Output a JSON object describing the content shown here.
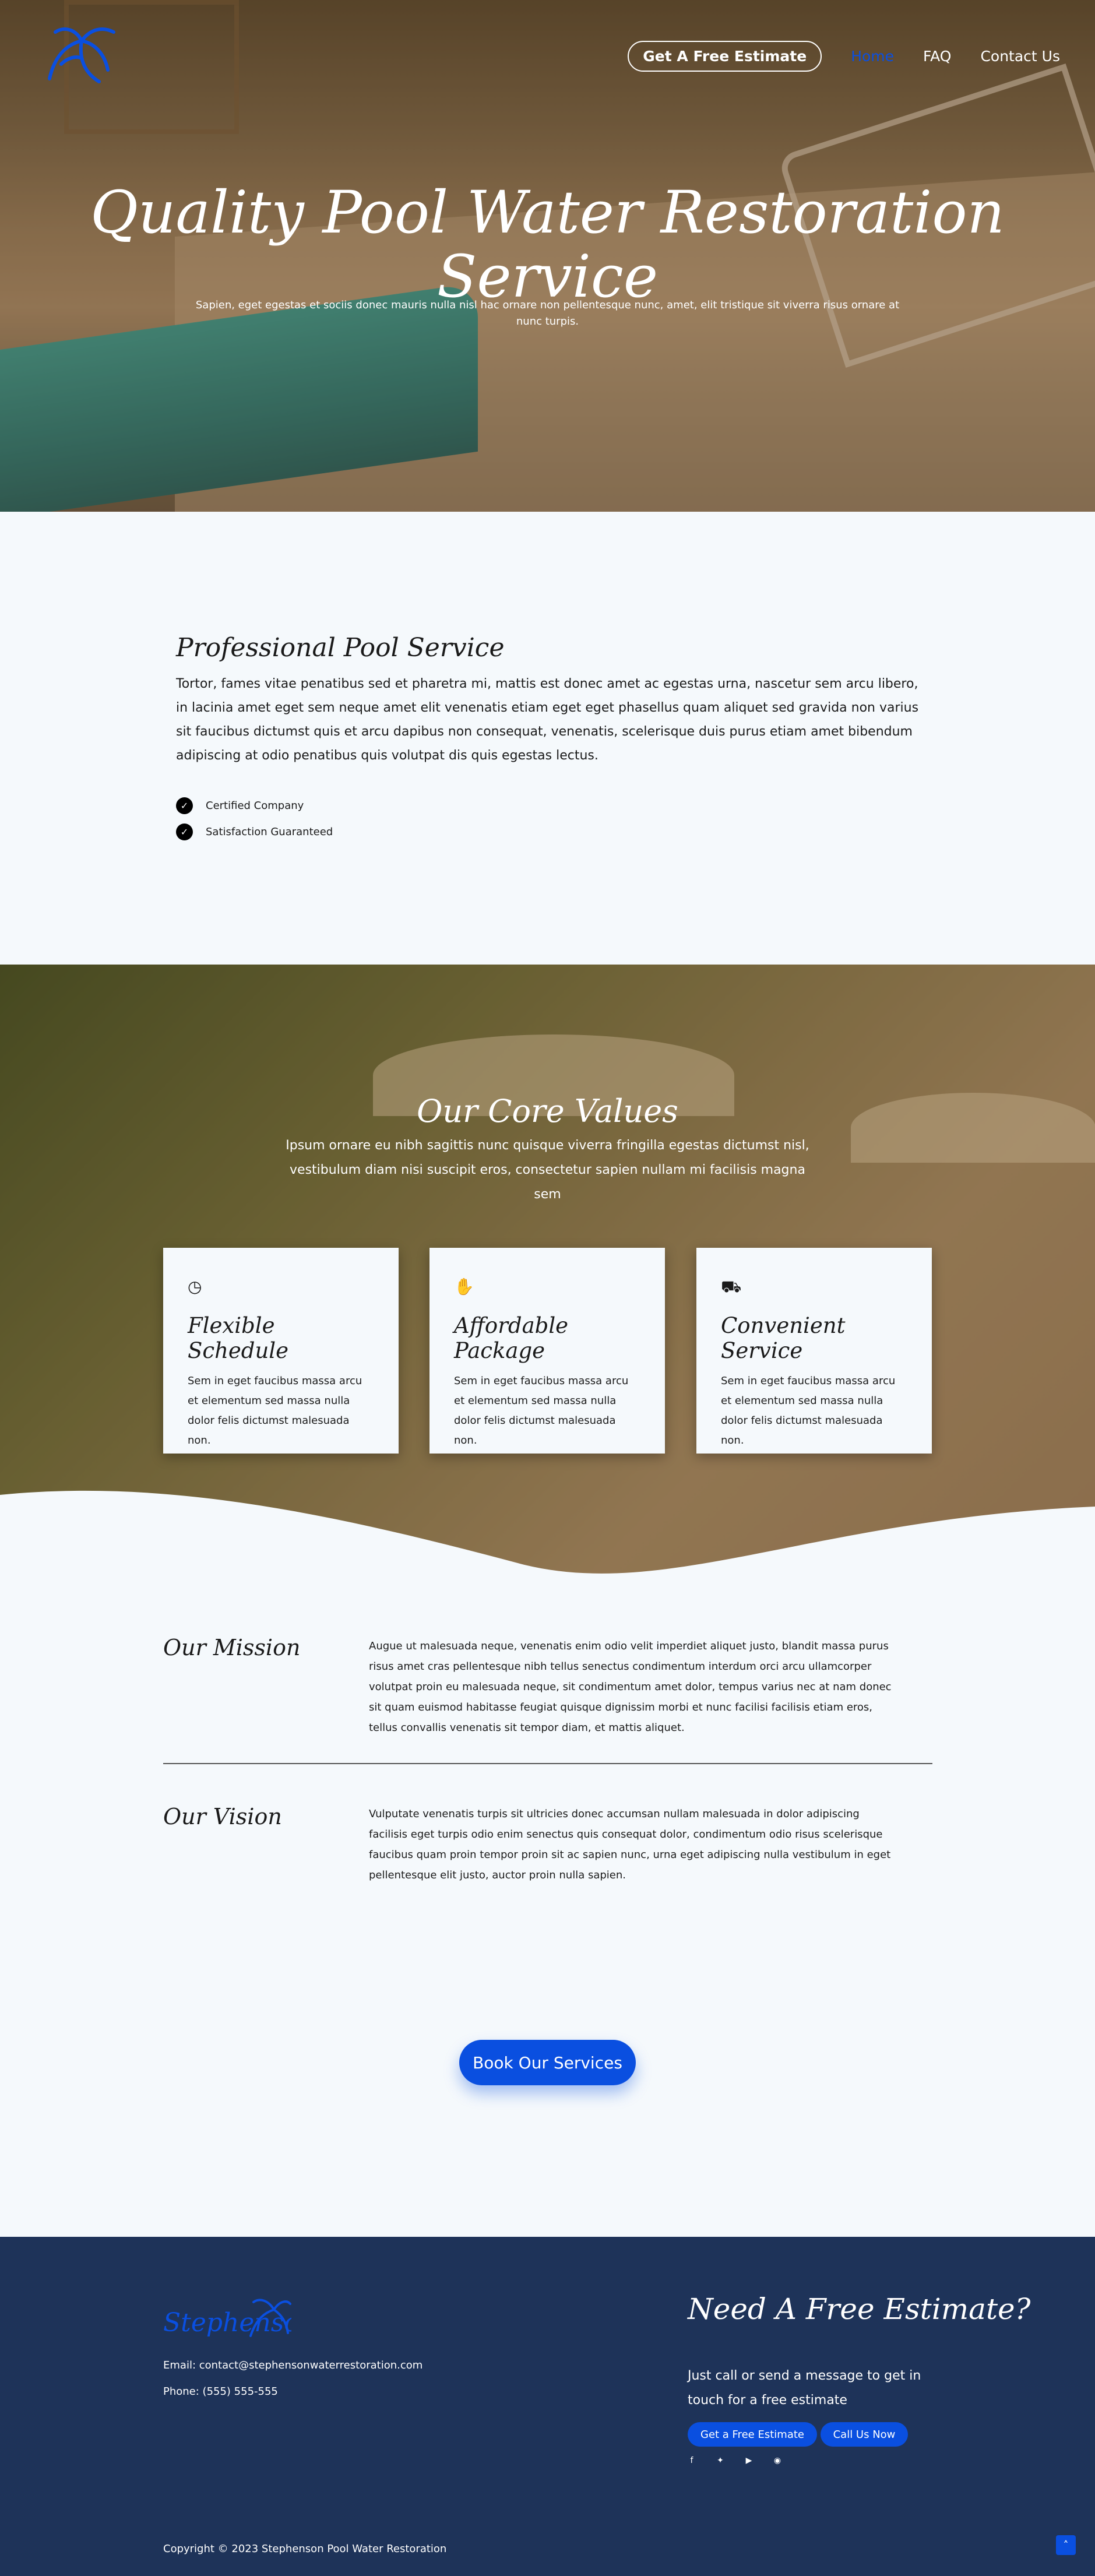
{
  "header": {
    "estimate_button": "Get A Free Estimate",
    "nav": [
      "Home",
      "FAQ",
      "Contact Us"
    ]
  },
  "hero": {
    "title": "Quality Pool Water Restoration Service",
    "subtitle": "Sapien, eget egestas et sociis donec mauris nulla nisl hac ornare non pellentesque nunc, amet, elit tristique sit viverra risus ornare at nunc turpis."
  },
  "professional": {
    "title": "Professional Pool Service",
    "body": "Tortor, fames vitae penatibus sed et pharetra mi, mattis est donec amet ac egestas urna, nascetur sem arcu libero, in lacinia amet eget sem neque amet elit venenatis etiam eget eget phasellus quam aliquet sed gravida non varius sit faucibus dictumst quis et arcu dapibus non consequat, venenatis, scelerisque duis purus etiam amet bibendum adipiscing at odio penatibus quis volutpat dis quis egestas lectus.",
    "checks": [
      "Certified Company",
      "Satisfaction Guaranteed"
    ]
  },
  "values": {
    "title": "Our Core Values",
    "lead": "Ipsum ornare eu nibh sagittis nunc quisque viverra fringilla egestas dictumst nisl, vestibulum diam nisi suscipit eros, consectetur sapien nullam mi facilisis magna sem",
    "cards": [
      {
        "icon": "clock-icon",
        "title": "Flexible Schedule",
        "body": "Sem in eget faucibus massa arcu et elementum sed massa nulla dolor felis dictumst malesuada non."
      },
      {
        "icon": "hand-holding-dollar-icon",
        "title": "Affordable Package",
        "body": "Sem in eget faucibus massa arcu et elementum sed massa nulla dolor felis dictumst malesuada non."
      },
      {
        "icon": "truck-icon",
        "title": "Convenient Service",
        "body": "Sem in eget faucibus massa arcu et elementum sed massa nulla dolor felis dictumst malesuada non."
      }
    ]
  },
  "mission": {
    "title": "Our Mission",
    "body": "Augue ut malesuada neque, venenatis enim odio velit imperdiet aliquet justo, blandit massa purus risus amet cras pellentesque nibh tellus senectus condimentum interdum orci arcu ullamcorper volutpat proin eu malesuada neque, sit condimentum amet dolor, tempus varius nec at nam donec sit quam euismod habitasse feugiat quisque dignissim morbi et nunc facilisi facilisis etiam eros, tellus convallis venenatis sit tempor diam, et mattis aliquet."
  },
  "vision": {
    "title": "Our Vision",
    "body": "Vulputate venenatis turpis sit ultricies donec accumsan nullam malesuada in dolor adipiscing facilisis eget turpis odio enim senectus quis consequat dolor, condimentum odio risus scelerisque faucibus quam proin tempor proin sit ac sapien nunc, urna eget adipiscing nulla vestibulum in eget pellentesque elit justo, auctor proin nulla sapien."
  },
  "cta": {
    "button": "Book Our Services"
  },
  "footer": {
    "logo_text": "Stephenson",
    "email": "Email: contact@stephensonwaterrestoration.com",
    "phone": "Phone: (555) 555-555",
    "estimate_title": "Need A Free Estimate?",
    "estimate_text": "Just call or send a message to get in touch for a free estimate",
    "estimate_button": "Get a Free Estimate",
    "call_button": "Call Us Now",
    "social": [
      "facebook-icon",
      "twitter-icon",
      "youtube-icon",
      "instagram-icon"
    ],
    "copyright": "Copyright © 2023 Stephenson Pool Water Restoration"
  },
  "colors": {
    "accent": "#0a4fe0",
    "footer_bg": "#1e3359",
    "page_bg": "#f5f9fc"
  }
}
